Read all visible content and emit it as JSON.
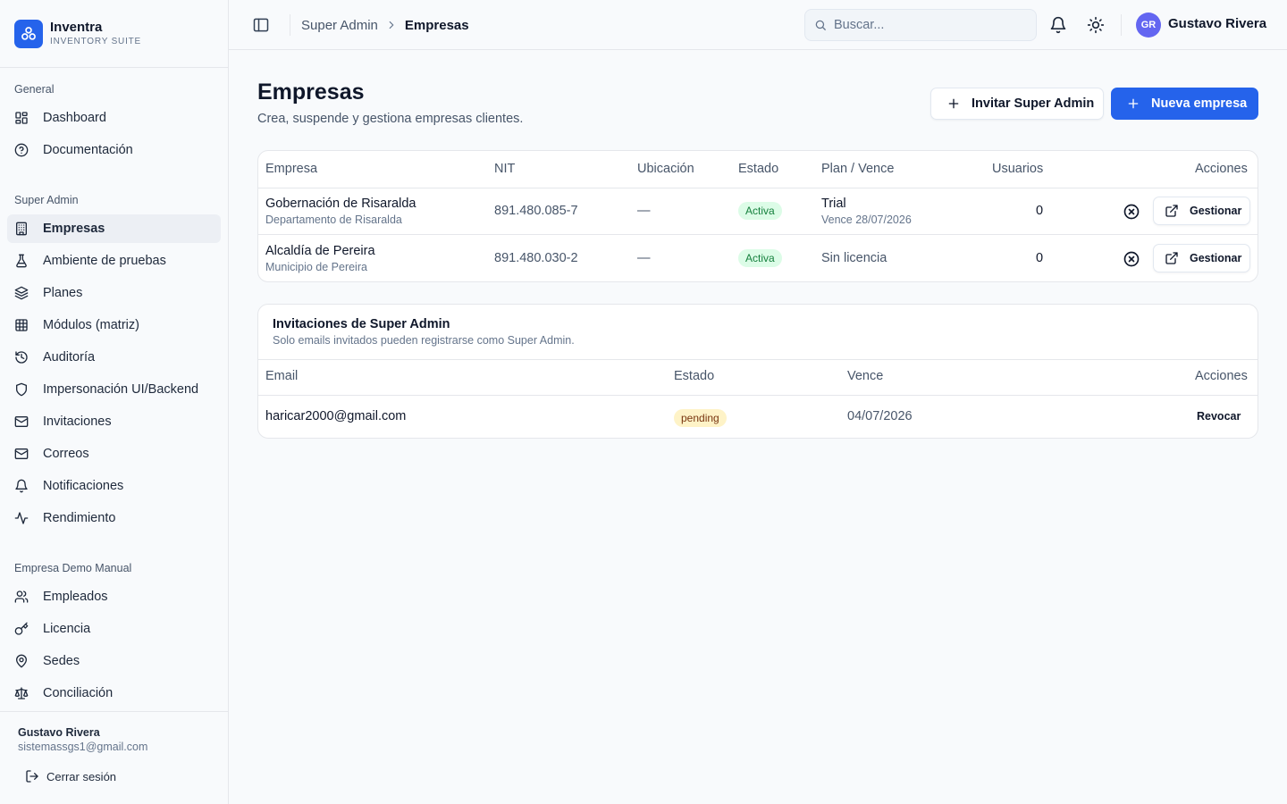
{
  "brand": {
    "name": "Inventra",
    "subtitle": "INVENTORY SUITE"
  },
  "sidebar": {
    "groups": [
      {
        "label": "General",
        "items": [
          {
            "label": "Dashboard",
            "icon": "dashboard-icon"
          },
          {
            "label": "Documentación",
            "icon": "help-circle-icon"
          }
        ]
      },
      {
        "label": "Super Admin",
        "items": [
          {
            "label": "Empresas",
            "icon": "building-icon",
            "active": true
          },
          {
            "label": "Ambiente de pruebas",
            "icon": "flask-icon"
          },
          {
            "label": "Planes",
            "icon": "layers-icon"
          },
          {
            "label": "Módulos (matriz)",
            "icon": "grid-table-icon"
          },
          {
            "label": "Auditoría",
            "icon": "history-icon"
          },
          {
            "label": "Impersonación UI/Backend",
            "icon": "shield-icon"
          },
          {
            "label": "Invitaciones",
            "icon": "mail-icon"
          },
          {
            "label": "Correos",
            "icon": "mail-icon"
          },
          {
            "label": "Notificaciones",
            "icon": "bell-icon"
          },
          {
            "label": "Rendimiento",
            "icon": "activity-icon"
          }
        ]
      },
      {
        "label": "Empresa Demo Manual",
        "items": [
          {
            "label": "Empleados",
            "icon": "users-icon"
          },
          {
            "label": "Licencia",
            "icon": "key-icon"
          },
          {
            "label": "Sedes",
            "icon": "map-pin-icon"
          },
          {
            "label": "Conciliación",
            "icon": "scale-icon"
          }
        ]
      }
    ],
    "footer": {
      "user_name": "Gustavo Rivera",
      "user_email": "sistemassgs1@gmail.com",
      "logout_label": "Cerrar sesión"
    }
  },
  "header": {
    "breadcrumb": {
      "parent": "Super Admin",
      "current": "Empresas"
    },
    "search_placeholder": "Buscar...",
    "avatar_initials": "GR",
    "user_name": "Gustavo Rivera"
  },
  "page": {
    "title": "Empresas",
    "subtitle": "Crea, suspende y gestiona empresas clientes.",
    "invite_button": "Invitar Super Admin",
    "new_button": "Nueva empresa"
  },
  "companies": {
    "columns": [
      "Empresa",
      "NIT",
      "Ubicación",
      "Estado",
      "Plan / Vence",
      "Usuarios",
      "Acciones"
    ],
    "rows": [
      {
        "name": "Gobernación de Risaralda",
        "sub": "Departamento de Risaralda",
        "nit": "891.480.085-7",
        "location": "—",
        "status": "Activa",
        "plan": "Trial",
        "expires": "Vence 28/07/2026",
        "users": "0",
        "manage_label": "Gestionar"
      },
      {
        "name": "Alcaldía de Pereira",
        "sub": "Municipio de Pereira",
        "nit": "891.480.030-2",
        "location": "—",
        "status": "Activa",
        "plan": "Sin licencia",
        "expires": "",
        "users": "0",
        "manage_label": "Gestionar"
      }
    ]
  },
  "invitations": {
    "title": "Invitaciones de Super Admin",
    "subtitle": "Solo emails invitados pueden registrarse como Super Admin.",
    "columns": [
      "Email",
      "Estado",
      "Vence",
      "Acciones"
    ],
    "rows": [
      {
        "email": "haricar2000@gmail.com",
        "status": "pending",
        "expires": "04/07/2026",
        "action": "Revocar"
      }
    ]
  },
  "colors": {
    "accent": "#2563eb",
    "active_badge_bg": "#dcfce7",
    "active_badge_text": "#15803d",
    "pending_badge_bg": "#fef3c7",
    "avatar": "#6366f1"
  }
}
